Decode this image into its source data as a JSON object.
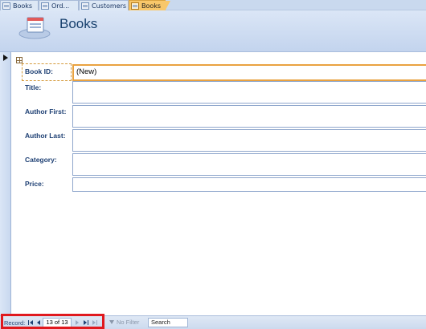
{
  "tabs": [
    {
      "label": "Books",
      "active": false
    },
    {
      "label": "Ord...",
      "active": false
    },
    {
      "label": "Customers",
      "active": false
    },
    {
      "label": "Books",
      "active": true
    }
  ],
  "header": {
    "title": "Books",
    "icon": "form-icon"
  },
  "form": {
    "fields": [
      {
        "label": "Book ID:",
        "value": "(New)"
      },
      {
        "label": "Title:",
        "value": ""
      },
      {
        "label": "Author First:",
        "value": ""
      },
      {
        "label": "Author Last:",
        "value": ""
      },
      {
        "label": "Category:",
        "value": ""
      },
      {
        "label": "Price:",
        "value": ""
      }
    ]
  },
  "navbar": {
    "record_label": "Record:",
    "record_position": "13 of 13",
    "filter_label": "No Filter",
    "search_label": "Search"
  },
  "colors": {
    "accent_tab": "#f8c76a",
    "header_bg": "#c3d4ee",
    "label_text": "#1d3f73",
    "highlight": "#e0191e"
  }
}
